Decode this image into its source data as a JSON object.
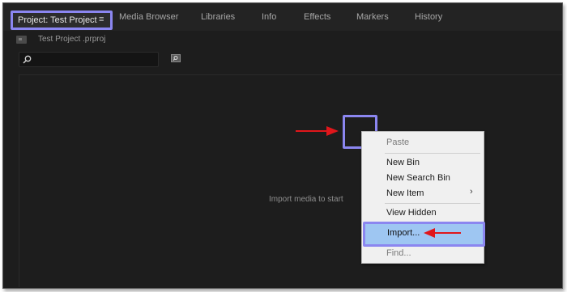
{
  "tabs": {
    "project": {
      "label": "Project: Test Project",
      "menu_icon": "≡"
    },
    "others": [
      {
        "label": "Media Browser"
      },
      {
        "label": "Libraries"
      },
      {
        "label": "Info"
      },
      {
        "label": "Effects"
      },
      {
        "label": "Markers"
      },
      {
        "label": "History"
      }
    ]
  },
  "project_file": {
    "name": "Test Project .prproj",
    "icon": "bin-icon"
  },
  "search": {
    "placeholder": "",
    "icon": "magnifier-icon"
  },
  "new_bin_button": {
    "icon": "magnifier-folder-icon"
  },
  "panel": {
    "hint": "Import media to start"
  },
  "context_menu": {
    "items": [
      {
        "label": "Paste",
        "enabled": false
      },
      {
        "label": "New Bin",
        "enabled": true
      },
      {
        "label": "New Search Bin",
        "enabled": true
      },
      {
        "label": "New Item",
        "enabled": true,
        "submenu": "›"
      },
      {
        "label": "View Hidden",
        "enabled": true
      },
      {
        "label": "Import...",
        "enabled": true,
        "highlighted": true
      },
      {
        "label": "Find...",
        "enabled": false
      }
    ]
  },
  "annotations": {
    "highlight_color": "#8b86f0",
    "arrow_color": "#e0161b"
  }
}
